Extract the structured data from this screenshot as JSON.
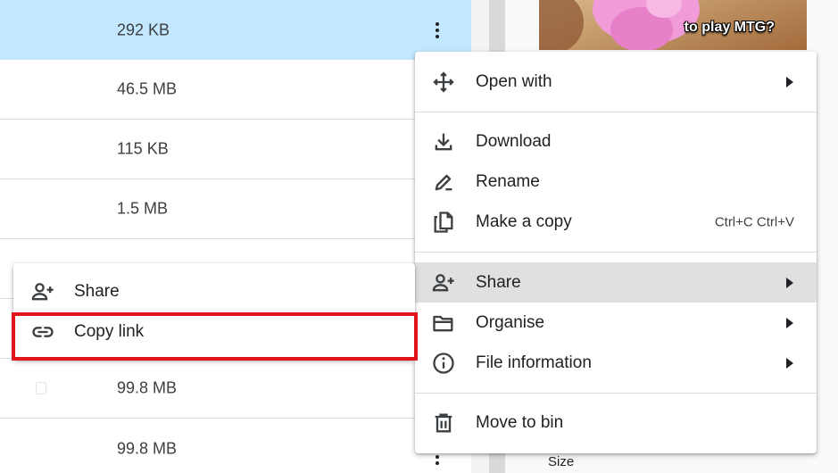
{
  "file_list": {
    "rows": [
      {
        "size": "292 KB",
        "selected": true
      },
      {
        "size": "46.5 MB",
        "selected": false
      },
      {
        "size": "115 KB",
        "selected": false
      },
      {
        "size": "1.5 MB",
        "selected": false
      },
      {
        "size": "",
        "selected": false
      },
      {
        "size": "",
        "selected": false
      },
      {
        "size": "99.8 MB",
        "selected": false
      },
      {
        "size": "99.8 MB",
        "selected": false
      }
    ]
  },
  "details_panel": {
    "preview_caption": "to play MTG?",
    "size_label": "Size"
  },
  "context_menu": {
    "open_with": {
      "label": "Open with",
      "icon": "open-with-icon"
    },
    "download": {
      "label": "Download",
      "icon": "download-icon"
    },
    "rename": {
      "label": "Rename",
      "icon": "rename-icon"
    },
    "make_copy": {
      "label": "Make a copy",
      "icon": "copy-icon",
      "shortcut": "Ctrl+C Ctrl+V"
    },
    "share": {
      "label": "Share",
      "icon": "add-person-icon",
      "hovered": true
    },
    "organise": {
      "label": "Organise",
      "icon": "folder-icon"
    },
    "file_information": {
      "label": "File information",
      "icon": "info-icon"
    },
    "move_to_bin": {
      "label": "Move to bin",
      "icon": "trash-icon"
    }
  },
  "share_submenu": {
    "share": {
      "label": "Share",
      "icon": "add-person-icon"
    },
    "copy_link": {
      "label": "Copy link",
      "icon": "link-icon",
      "highlighted": true
    }
  },
  "colors": {
    "selected_row": "#c2e7ff",
    "hover_item": "#e0e0e0",
    "highlight_border": "#e0121c"
  }
}
